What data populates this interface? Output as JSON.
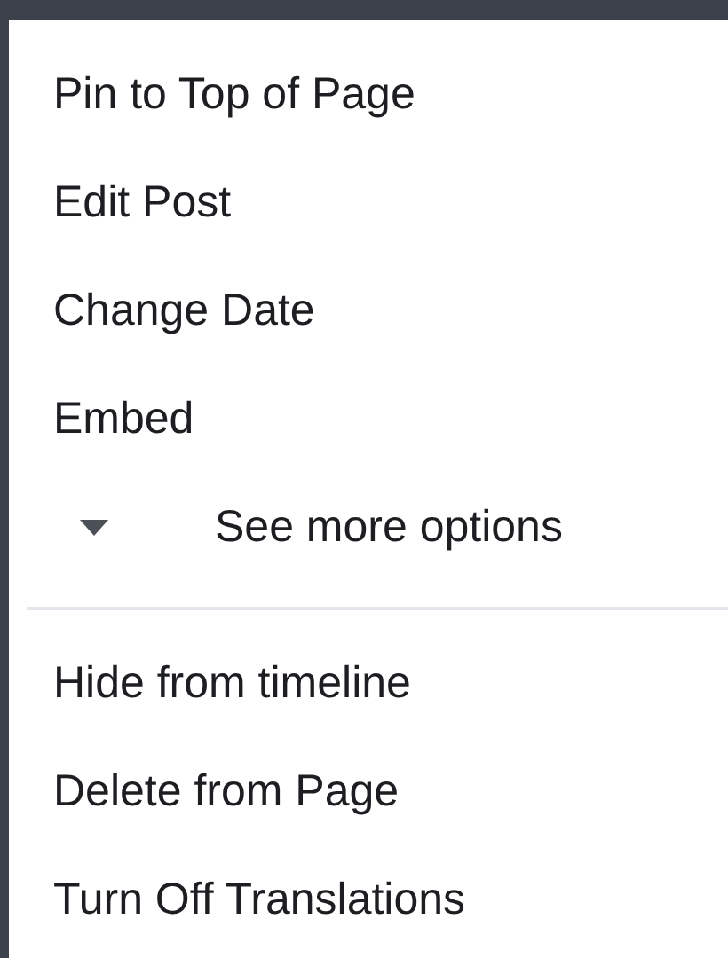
{
  "menu": {
    "sections": [
      {
        "items": [
          {
            "kind": "action",
            "label": "Pin to Top of Page"
          },
          {
            "kind": "action",
            "label": "Edit Post"
          },
          {
            "kind": "action",
            "label": "Change Date"
          },
          {
            "kind": "action",
            "label": "Embed"
          },
          {
            "kind": "expander",
            "label": "See more options"
          }
        ]
      },
      {
        "items": [
          {
            "kind": "action",
            "label": "Hide from timeline"
          },
          {
            "kind": "action",
            "label": "Delete from Page"
          },
          {
            "kind": "action",
            "label": "Turn Off Translations"
          }
        ]
      }
    ]
  }
}
